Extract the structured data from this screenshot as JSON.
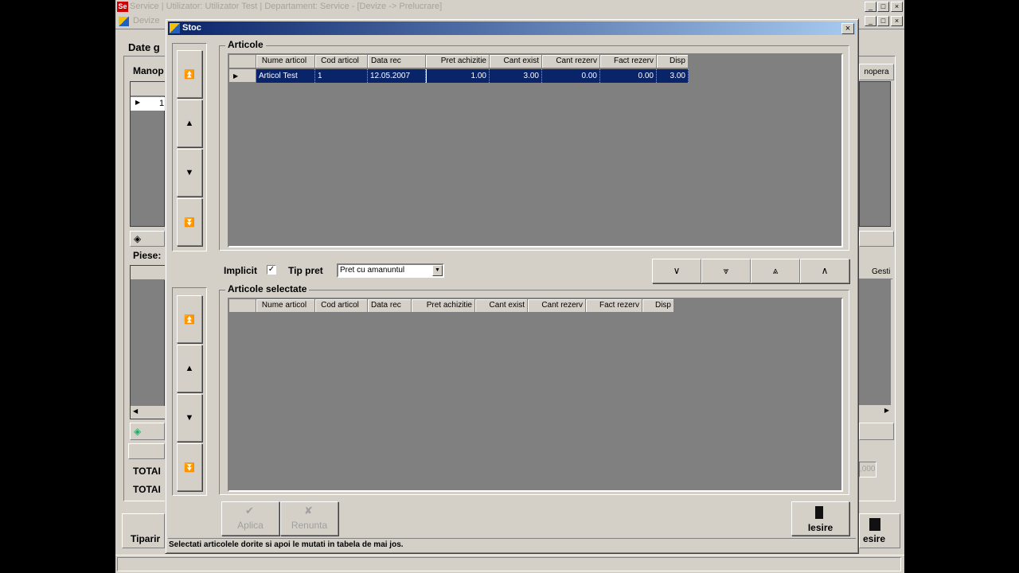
{
  "main_window": {
    "logo": "Se",
    "title": "Service | Utilizator: Utilizator Test | Departament: Service - [Devize -> Prelucrare]",
    "child_title": "Devize",
    "caption_buttons": [
      "_",
      "□",
      "×"
    ],
    "bg_labels": {
      "date": "Date g",
      "manop": "Manop",
      "piese": "Piese:",
      "total1": "TOTAI",
      "total2": "TOTAI",
      "tiparire": "Tiparir",
      "manopera_btn": "nopera",
      "gesti": "Gesti",
      "sum": ",000",
      "iesire": "esire",
      "row1": "1"
    }
  },
  "dialog": {
    "title": "Stoc",
    "close": "×",
    "articole_section": "Articole",
    "articole_columns": [
      "Nume articol",
      "Cod articol",
      "Data rec",
      "Pret achizitie",
      "Cant exist",
      "Cant rezerv",
      "Fact rezerv",
      "Disp"
    ],
    "articole_rows": [
      [
        "Articol Test",
        "1",
        "12.05.2007",
        "1.00",
        "3.00",
        "0.00",
        "0.00",
        "3.00"
      ]
    ],
    "implicit_label": "Implicit",
    "implicit_checked": "✓",
    "tip_pret_label": "Tip pret",
    "tip_pret_value": "Pret cu amanuntul",
    "selectate_section": "Articole selectate",
    "selectate_columns": [
      "Nume articol",
      "Cod articol",
      "Data rec",
      "Pret achizitie",
      "Cant exist",
      "Cant rezerv",
      "Fact rezerv",
      "Disp"
    ],
    "aplica": "Aplica",
    "renunta": "Renunta",
    "iesire": "Iesire",
    "status": "Selectati articolele dorite si apoi le mutati in tabela de mai jos."
  }
}
